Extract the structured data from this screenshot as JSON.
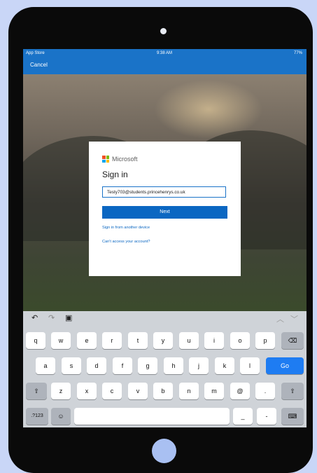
{
  "statusbar": {
    "left": "App Store",
    "time": "9:38 AM",
    "battery": "77%"
  },
  "nav": {
    "cancel": "Cancel"
  },
  "signin_card": {
    "brand": "Microsoft",
    "title": "Sign in",
    "email_value": "Testy703@students.princehenrys.co.uk",
    "next_label": "Next",
    "link_other_device": "Sign in from another device",
    "link_cant_access": "Can't access your account?"
  },
  "keyboard": {
    "row1": [
      "q",
      "w",
      "e",
      "r",
      "t",
      "y",
      "u",
      "i",
      "o",
      "p"
    ],
    "row2": [
      "a",
      "s",
      "d",
      "f",
      "g",
      "h",
      "j",
      "k",
      "l"
    ],
    "go": "Go",
    "row3": [
      "z",
      "x",
      "c",
      "v",
      "b",
      "n",
      "m",
      "@",
      "."
    ],
    "num": ".?123",
    "underscore": "_",
    "dash": "-"
  }
}
